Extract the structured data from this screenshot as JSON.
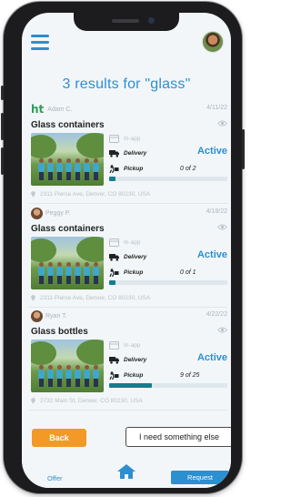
{
  "header": {
    "title": "3 results for \"glass\""
  },
  "results": [
    {
      "user": "Adam C.",
      "user_logo": "ht",
      "date": "4/11/22",
      "title": "Glass containers",
      "in_app": "In-app",
      "delivery": "Delivery",
      "pickup": "Pickup",
      "status": "Active",
      "count": "0 of 2",
      "progress": 0.05,
      "address": "2311 Pierce Ave, Denver, CO 80230, USA"
    },
    {
      "user": "Peggy P.",
      "date": "4/18/22",
      "title": "Glass containers",
      "in_app": "In-app",
      "delivery": "Delivery",
      "pickup": "Pickup",
      "status": "Active",
      "count": "0 of 1",
      "progress": 0.05,
      "address": "2311 Pierce Ave, Denver, CO 80230, USA"
    },
    {
      "user": "Ryan T.",
      "date": "4/22/22",
      "title": "Glass bottles",
      "in_app": "In-app",
      "delivery": "Delivery",
      "pickup": "Pickup",
      "status": "Active",
      "count": "9 of 25",
      "progress": 0.36,
      "address": "2732 Main St, Denver, CO 80230, USA"
    }
  ],
  "actions": {
    "back_label": "Back",
    "else_label": "I need something else"
  },
  "nav": {
    "offer_label": "Offer",
    "request_label": "Request",
    "home_icon": "home-icon"
  },
  "colors": {
    "accent": "#2c8fd0",
    "back_button": "#f29a25",
    "progress": "#167c8e",
    "logo_green": "#2e9e5b"
  }
}
